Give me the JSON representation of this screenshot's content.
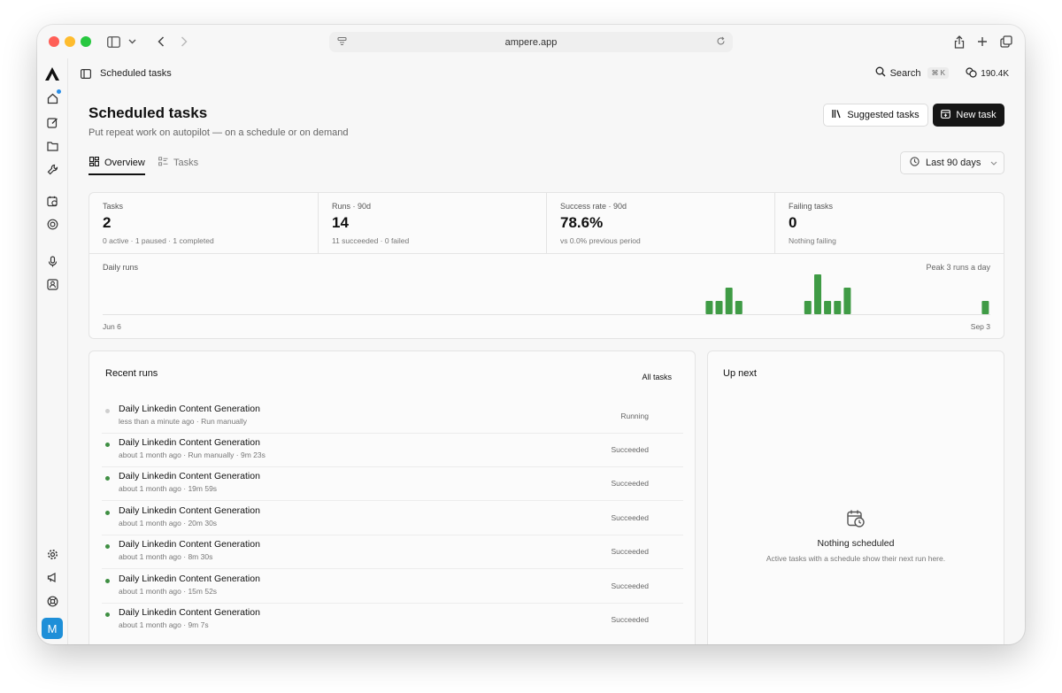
{
  "browser": {
    "url": "ampere.app"
  },
  "header": {
    "crumb": "Scheduled tasks",
    "search_label": "Search",
    "search_shortcut": "⌘ K",
    "credits": "190.4K"
  },
  "page": {
    "title": "Scheduled tasks",
    "subtitle": "Put repeat work on autopilot — on a schedule or on demand",
    "suggested_button": "Suggested tasks",
    "new_task_button": "New task",
    "tabs": [
      {
        "label": "Overview",
        "active": true
      },
      {
        "label": "Tasks",
        "active": false
      }
    ],
    "range_label": "Last 90 days"
  },
  "stats": [
    {
      "label": "Tasks",
      "value": "2",
      "note": "0 active · 1 paused · 1 completed"
    },
    {
      "label": "Runs · 90d",
      "value": "14",
      "note": "11 succeeded · 0 failed"
    },
    {
      "label": "Success rate · 90d",
      "value": "78.6%",
      "note": "vs 0.0% previous period"
    },
    {
      "label": "Failing tasks",
      "value": "0",
      "note": "Nothing failing"
    }
  ],
  "chart_data": {
    "type": "bar",
    "title": "Daily runs",
    "annotation": "Peak 3 runs a day",
    "x_start_label": "Jun 6",
    "x_end_label": "Sep 3",
    "ylim": [
      0,
      3
    ],
    "bar_color": "#3f9b45",
    "days": 90,
    "bars": [
      {
        "day_index": 61,
        "value": 1
      },
      {
        "day_index": 62,
        "value": 1
      },
      {
        "day_index": 63,
        "value": 2
      },
      {
        "day_index": 64,
        "value": 1
      },
      {
        "day_index": 71,
        "value": 1
      },
      {
        "day_index": 72,
        "value": 3
      },
      {
        "day_index": 73,
        "value": 1
      },
      {
        "day_index": 74,
        "value": 1
      },
      {
        "day_index": 75,
        "value": 2
      },
      {
        "day_index": 89,
        "value": 1
      }
    ]
  },
  "recent_runs": {
    "title": "Recent runs",
    "all_link": "All tasks",
    "items": [
      {
        "name": "Daily Linkedin Content Generation",
        "meta": "less than a minute ago · Run manually",
        "status": "Running",
        "state": "running"
      },
      {
        "name": "Daily Linkedin Content Generation",
        "meta": "about 1 month ago · Run manually · 9m 23s",
        "status": "Succeeded",
        "state": "succeeded"
      },
      {
        "name": "Daily Linkedin Content Generation",
        "meta": "about 1 month ago · 19m 59s",
        "status": "Succeeded",
        "state": "succeeded"
      },
      {
        "name": "Daily Linkedin Content Generation",
        "meta": "about 1 month ago · 20m 30s",
        "status": "Succeeded",
        "state": "succeeded"
      },
      {
        "name": "Daily Linkedin Content Generation",
        "meta": "about 1 month ago · 8m 30s",
        "status": "Succeeded",
        "state": "succeeded"
      },
      {
        "name": "Daily Linkedin Content Generation",
        "meta": "about 1 month ago · 15m 52s",
        "status": "Succeeded",
        "state": "succeeded"
      },
      {
        "name": "Daily Linkedin Content Generation",
        "meta": "about 1 month ago · 9m 7s",
        "status": "Succeeded",
        "state": "succeeded"
      }
    ]
  },
  "up_next": {
    "title": "Up next",
    "empty_title": "Nothing scheduled",
    "empty_hint": "Active tasks with a schedule show their next run here."
  },
  "user": {
    "initial": "M"
  }
}
